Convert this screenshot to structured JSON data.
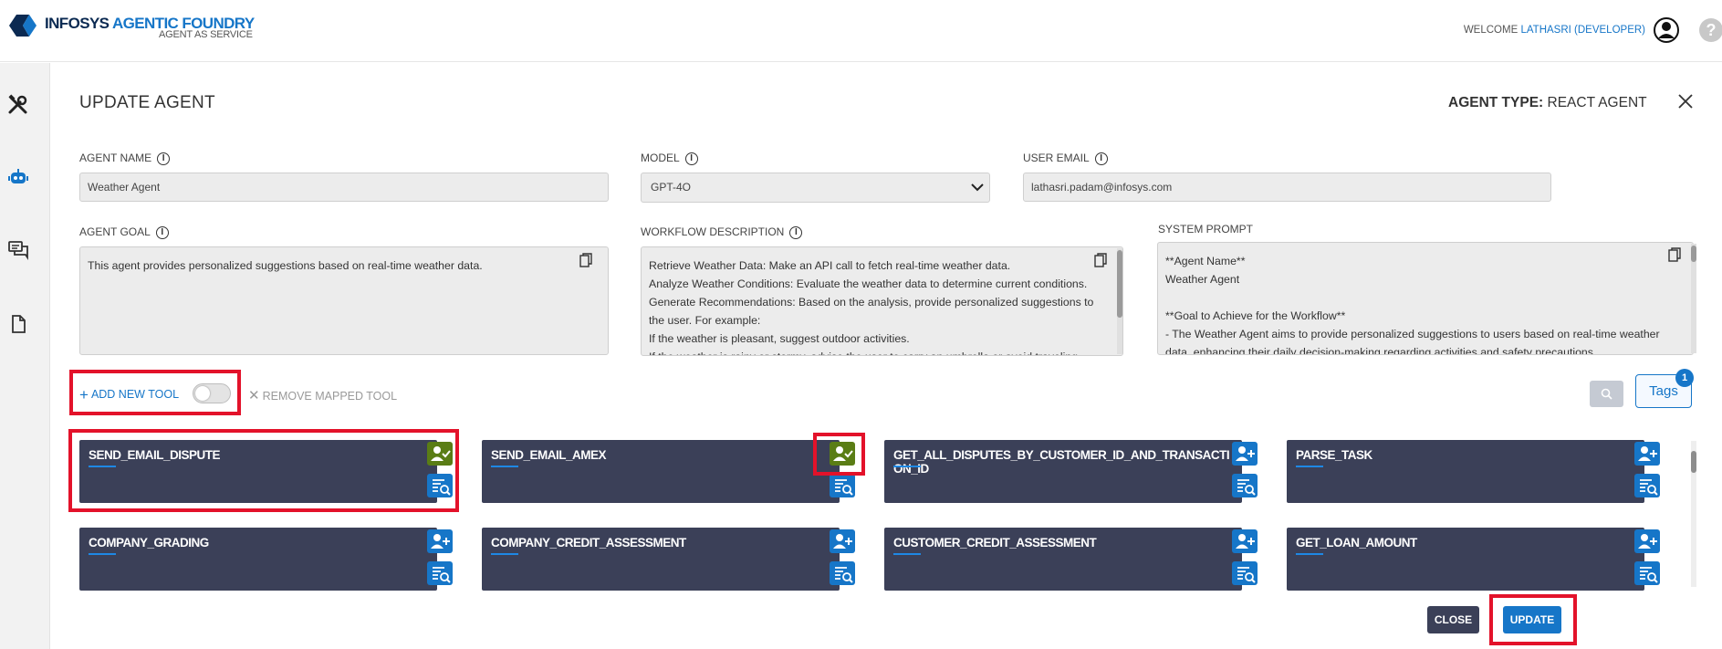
{
  "header": {
    "logo_part1": "INFOSYS",
    "logo_part2": "AGENTIC FOUNDRY",
    "logo_sub": "AGENT AS SERVICE",
    "welcome_prefix": "WELCOME",
    "welcome_user": "LATHASRI (DEVELOPER)",
    "brand_color": "#1676c8"
  },
  "sidebar": {
    "icons": [
      "tools-icon",
      "robot-icon",
      "chat-icon",
      "document-icon"
    ]
  },
  "page": {
    "title": "UPDATE AGENT",
    "agent_type_label": "AGENT TYPE:",
    "agent_type_value": "REACT AGENT"
  },
  "form": {
    "agent_name_label": "AGENT NAME",
    "agent_name_value": "Weather Agent",
    "model_label": "MODEL",
    "model_value": "GPT-4O",
    "user_email_label": "USER EMAIL",
    "user_email_value": "lathasri.padam@infosys.com",
    "agent_goal_label": "AGENT GOAL",
    "agent_goal_value": "This agent provides personalized suggestions based on real-time weather data.",
    "workflow_label": "WORKFLOW DESCRIPTION",
    "workflow_lines": [
      "Retrieve Weather Data: Make an API call to fetch real-time weather data.",
      "Analyze Weather Conditions: Evaluate the weather data to determine current conditions.",
      "Generate Recommendations: Based on the analysis, provide personalized suggestions to the user. For example:",
      "If the weather is pleasant, suggest outdoor activities.",
      "If the weather is rainy or stormy, advise the user to carry an umbrella or avoid traveling."
    ],
    "system_prompt_label": "SYSTEM PROMPT",
    "system_prompt_lines": [
      "**Agent Name**",
      "Weather Agent",
      "",
      "**Goal to Achieve for the Workflow**",
      "- The Weather Agent aims to provide personalized suggestions to users based on real-time weather data, enhancing their daily decision-making regarding activities and safety precautions."
    ]
  },
  "toolbar": {
    "add_new_tool": "ADD NEW TOOL",
    "remove_mapped_tool": "REMOVE MAPPED TOOL",
    "tags_label": "Tags",
    "tags_count": "1"
  },
  "tools": [
    {
      "name": "SEND_EMAIL_DISPUTE",
      "mapped": true
    },
    {
      "name": "SEND_EMAIL_AMEX",
      "mapped": true
    },
    {
      "name": "GET_ALL_DISPUTES_BY_CUSTOMER_ID_AND_TRANSACTION_ID",
      "mapped": false
    },
    {
      "name": "PARSE_TASK",
      "mapped": false
    },
    {
      "name": "COMPANY_GRADING",
      "mapped": false
    },
    {
      "name": "COMPANY_CREDIT_ASSESSMENT",
      "mapped": false
    },
    {
      "name": "CUSTOMER_CREDIT_ASSESSMENT",
      "mapped": false
    },
    {
      "name": "GET_LOAN_AMOUNT",
      "mapped": false
    }
  ],
  "footer": {
    "close_label": "CLOSE",
    "update_label": "UPDATE"
  }
}
